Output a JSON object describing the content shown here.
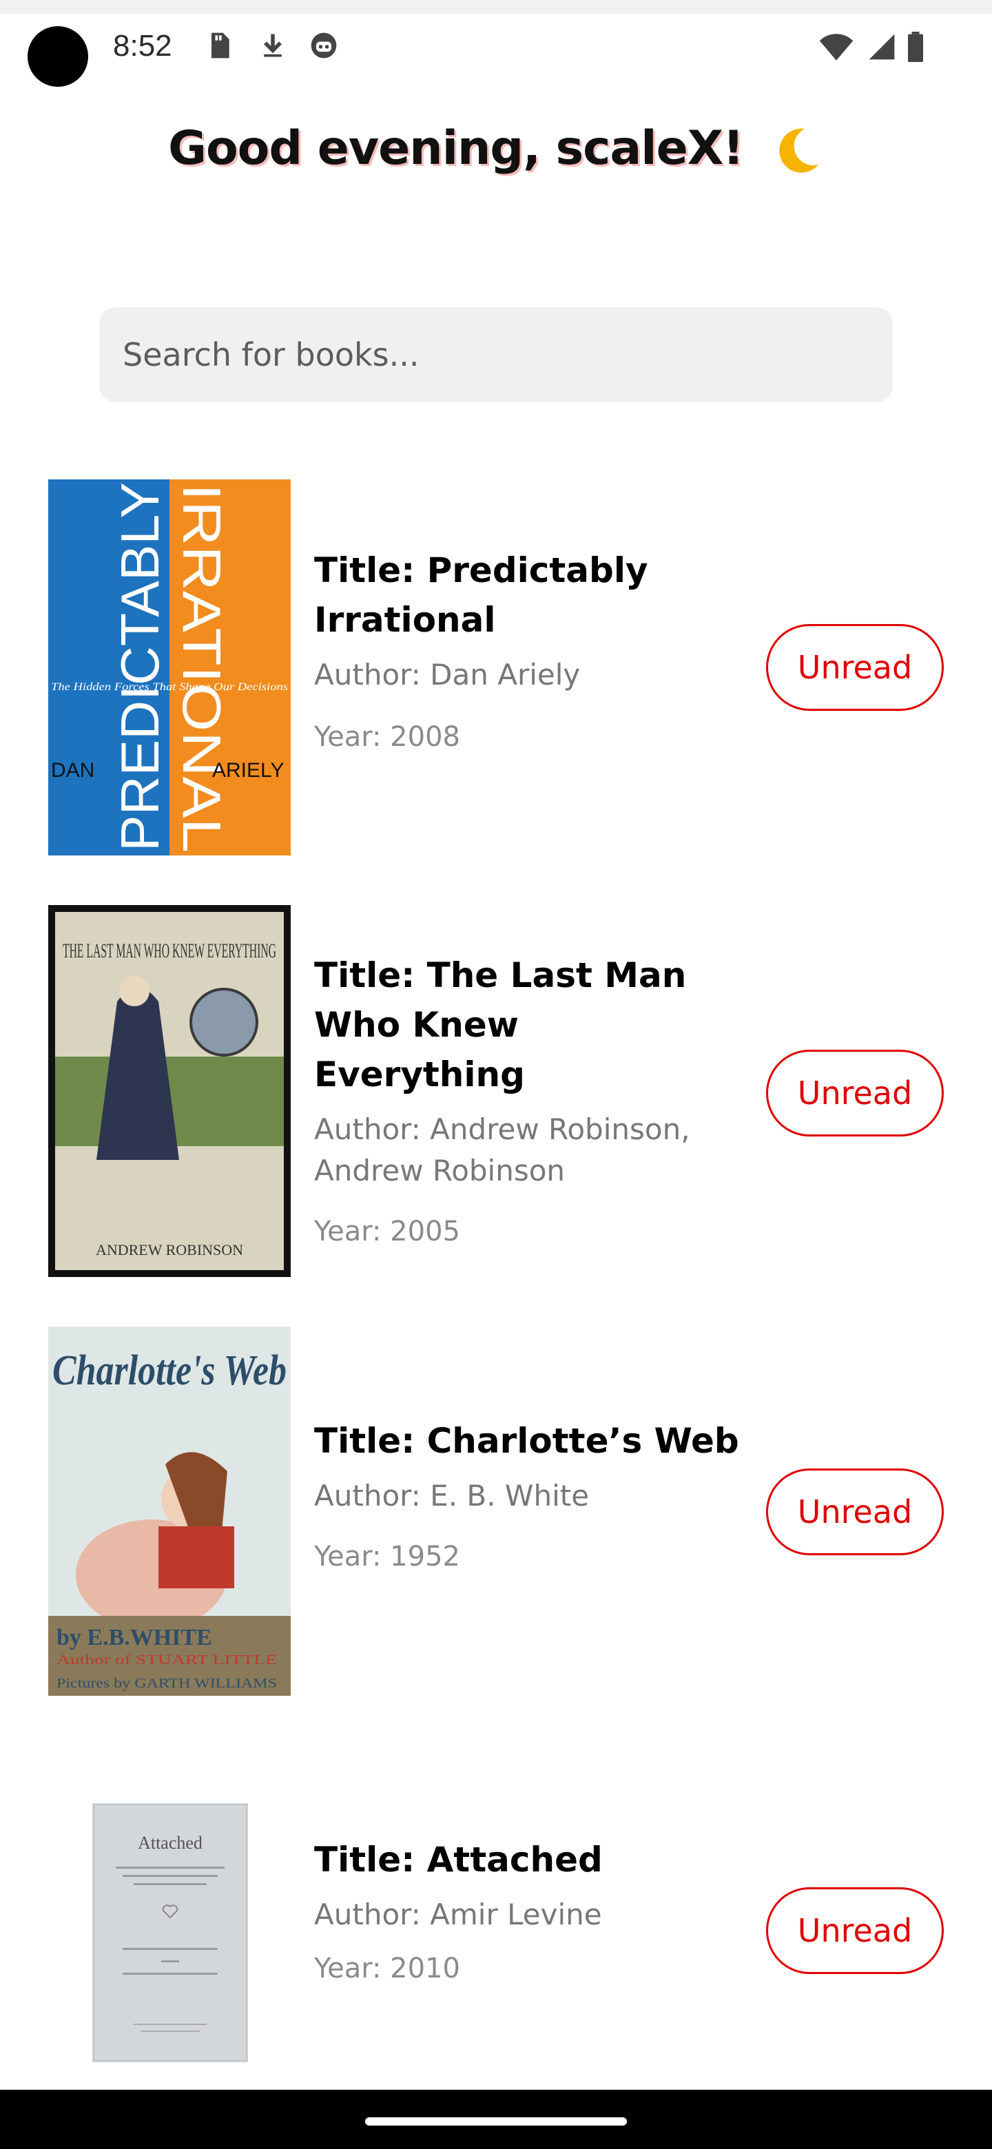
{
  "status_bar": {
    "time": "8:52",
    "icons": [
      "sd-card-icon",
      "download-icon",
      "robot-icon"
    ],
    "right_icons": [
      "wifi-icon",
      "cellular-signal-icon",
      "battery-icon"
    ]
  },
  "greeting": {
    "text": "Good evening, scaleX!",
    "icon": "crescent-moon-icon"
  },
  "search": {
    "placeholder": "Search for books..."
  },
  "books": [
    {
      "title": "Title: Predictably Irrational",
      "author": "Author: Dan Ariely",
      "year": "Year: 2008",
      "status": "Unread",
      "cover": {
        "left_text": "PREDICTABLY",
        "right_text": "IRRATIONAL",
        "tagline": "The Hidden Forces That Shape Our Decisions",
        "author_left": "DAN",
        "author_right": "ARIELY",
        "left_color": "#1e73be",
        "right_color": "#f28c1e"
      }
    },
    {
      "title": "Title: The Last Man Who Knew Everything",
      "author": "Author: Andrew Robinson, Andrew Robinson",
      "year": "Year: 2005",
      "status": "Unread",
      "cover": {
        "heading": "THE LAST MAN WHO KNEW EVERYTHING",
        "byline": "ANDREW ROBINSON"
      }
    },
    {
      "title": "Title: Charlotte’s Web",
      "author": "Author: E. B. White",
      "year": "Year: 1952",
      "status": "Unread",
      "cover": {
        "heading": "Charlotte's Web",
        "byline": "by E.B.WHITE",
        "subline": "Author of STUART LITTLE",
        "illustrator": "Pictures by GARTH WILLIAMS"
      }
    },
    {
      "title": "Title: Attached",
      "author": "Author: Amir Levine",
      "year": "Year: 2010",
      "status": "Unread",
      "cover": {
        "heading": "Attached"
      }
    }
  ],
  "colors": {
    "accent": "#e00000",
    "search_bg": "#f0f0f0"
  }
}
